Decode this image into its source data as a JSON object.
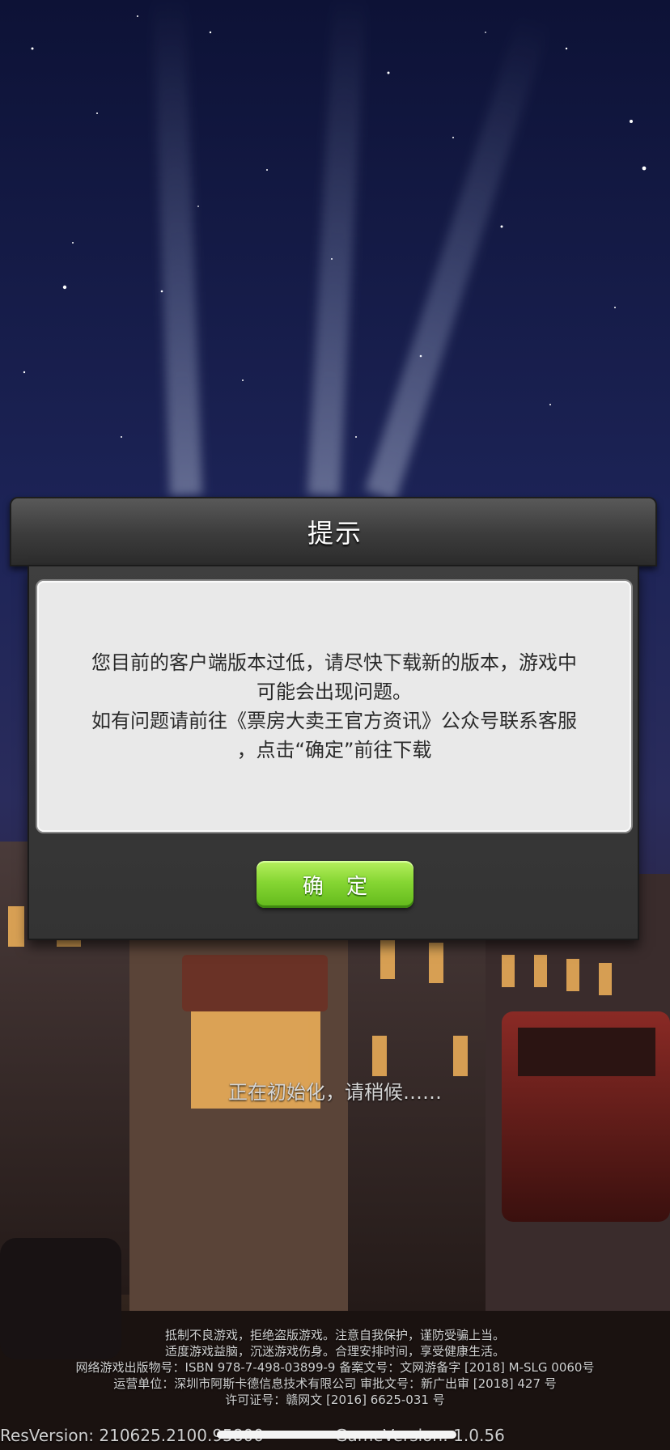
{
  "dialog": {
    "title": "提示",
    "message_lines": [
      "您目前的客户端版本过低，请尽快下载新的版本，游戏中",
      "可能会出现问题。",
      "如有问题请前往《票房大卖王官方资讯》公众号联系客服",
      "，点击“确定”前往下载"
    ],
    "confirm_label": "确 定"
  },
  "loading_text": "正在初始化，请稍候……",
  "notice_lines": [
    "抵制不良游戏，拒绝盗版游戏。注意自我保护，谨防受骗上当。",
    "适度游戏益脑，沉迷游戏伤身。合理安排时间，享受健康生活。",
    "网络游戏出版物号：ISBN 978-7-498-03899-9  备案文号：文网游备字 [2018] M-SLG 0060号",
    "运营单位：深圳市阿斯卡德信息技术有限公司          审批文号：新广出审 [2018] 427 号",
    "许可证号：赣网文 [2016] 6625-031 号"
  ],
  "version": {
    "res": "ResVersion: 210625.2100.95800",
    "game": "GameVersion: 1.0.56"
  },
  "colors": {
    "button_green": "#86d633",
    "dialog_header": "#3b3b3b",
    "message_panel": "#e9e9e9"
  }
}
